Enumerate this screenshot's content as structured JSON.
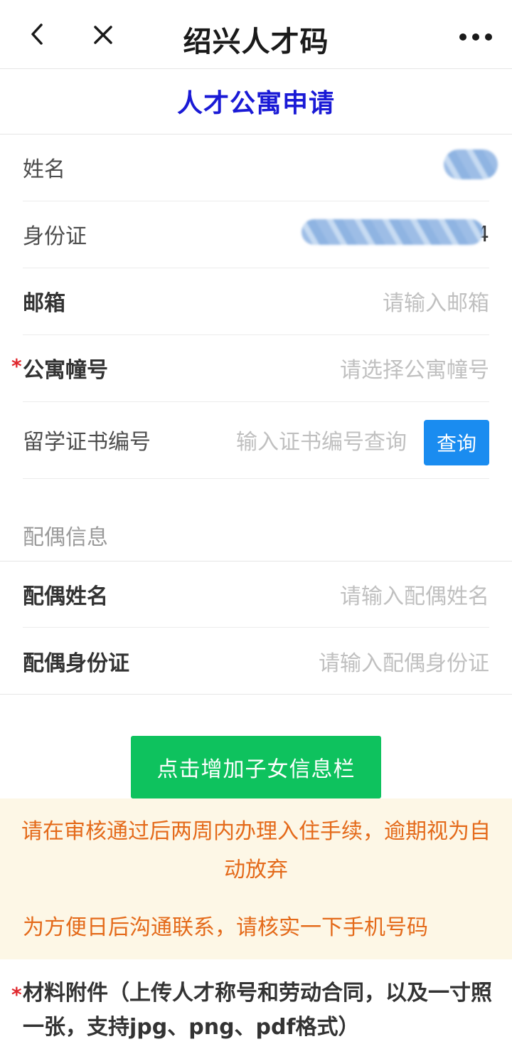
{
  "navbar": {
    "title": "绍兴人才码",
    "back_icon": "chevron-left-icon",
    "close_icon": "close-icon",
    "more_icon": "more-dots-icon"
  },
  "page": {
    "title": "人才公寓申请"
  },
  "form": {
    "name": {
      "label": "姓名"
    },
    "id_card": {
      "label": "身份证",
      "value_tail": "4"
    },
    "email": {
      "label": "邮箱",
      "placeholder": "请输入邮箱"
    },
    "building": {
      "required_mark": "*",
      "label": "公寓幢号",
      "placeholder": "请选择公寓幢号"
    },
    "certificate": {
      "label": "留学证书编号",
      "placeholder": "输入证书编号查询",
      "query_label": "查询"
    }
  },
  "spouse": {
    "section_label": "配偶信息",
    "name": {
      "label": "配偶姓名",
      "placeholder": "请输入配偶姓名"
    },
    "id_card": {
      "label": "配偶身份证",
      "placeholder": "请输入配偶身份证"
    }
  },
  "add_child_button": "点击增加子女信息栏",
  "notice": {
    "line1": "请在审核通过后两周内办理入住手续，逾期视为自动放弃",
    "line2": "为方便日后沟通联系，请核实一下手机号码",
    "color": "#e46a1a",
    "background": "#fdf7e6"
  },
  "attachment": {
    "required_mark": "*",
    "label": "材料附件（上传人才称号和劳动合同，以及一寸照一张，支持jpg、png、pdf格式）"
  },
  "colors": {
    "title_blue": "#1a1ad6",
    "query_button": "#1a8cf0",
    "add_button": "#0ec25e",
    "required": "#e0282e"
  }
}
